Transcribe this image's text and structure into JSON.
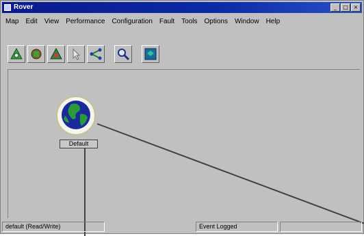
{
  "window": {
    "title": "Rover",
    "min_label": "_",
    "max_label": "□",
    "close_label": "×"
  },
  "menu": [
    "Map",
    "Edit",
    "View",
    "Performance",
    "Configuration",
    "Fault",
    "Tools",
    "Options",
    "Window",
    "Help"
  ],
  "toolbar": {
    "icons": [
      "map-tool-icon",
      "device-tool-icon",
      "alert-tool-icon",
      "pointer-tool-icon",
      "link-tool-icon",
      "zoom-tool-icon",
      "help-tool-icon"
    ]
  },
  "map": {
    "node_label": "Default"
  },
  "status": {
    "left": "default (Read/Write)",
    "right": "Event Logged"
  },
  "colors": {
    "title_bar": "#0b2aa8",
    "window_bg": "#c0c0c0"
  }
}
